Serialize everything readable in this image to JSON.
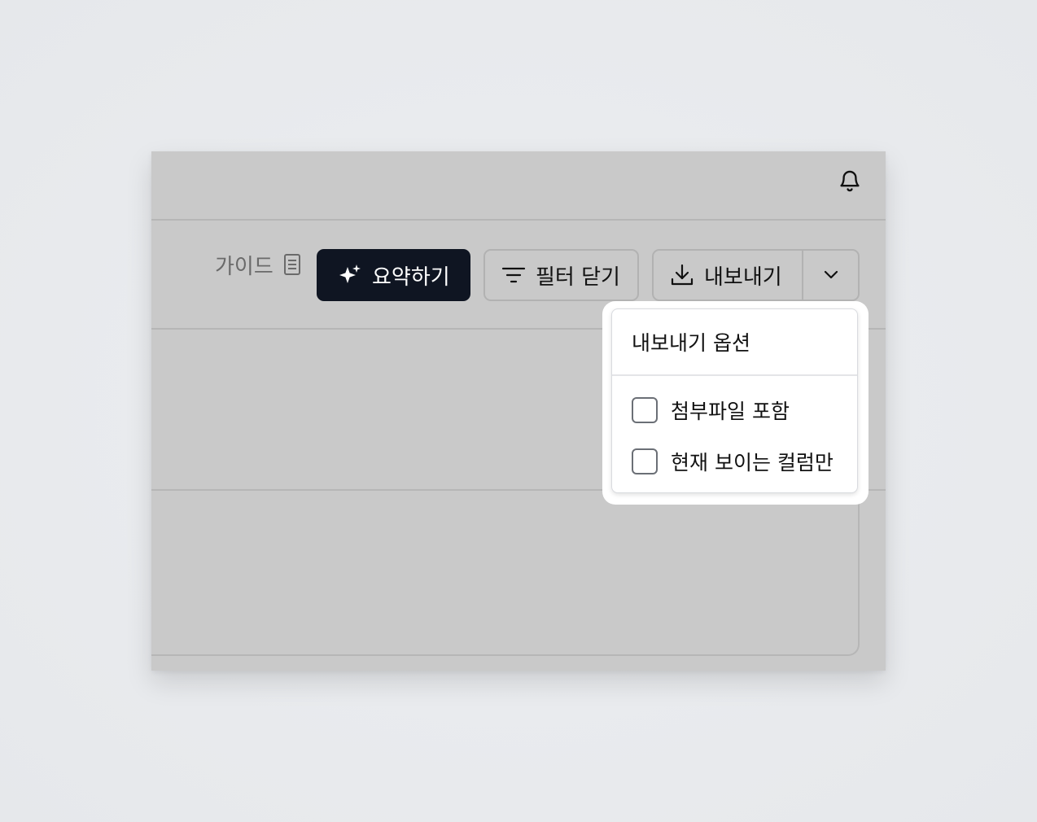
{
  "toolbar": {
    "guide_label": "가이드",
    "summary_label": "요약하기",
    "filter_label": "필터 닫기",
    "export_label": "내보내기"
  },
  "export_menu": {
    "title": "내보내기 옵션",
    "options": [
      {
        "label": "첨부파일 포함",
        "checked": false
      },
      {
        "label": "현재 보이는 컬럼만",
        "checked": false
      }
    ]
  },
  "icons": {
    "notifications": "bell-icon",
    "guide": "document-icon",
    "summary": "sparkle-icon",
    "filter": "filter-lines-icon",
    "export": "download-icon",
    "export_toggle": "chevron-down-icon"
  },
  "colors": {
    "summary_button_bg": "#0f1522",
    "overlay_bg": "#c9c9c9",
    "menu_bg": "#ffffff"
  }
}
